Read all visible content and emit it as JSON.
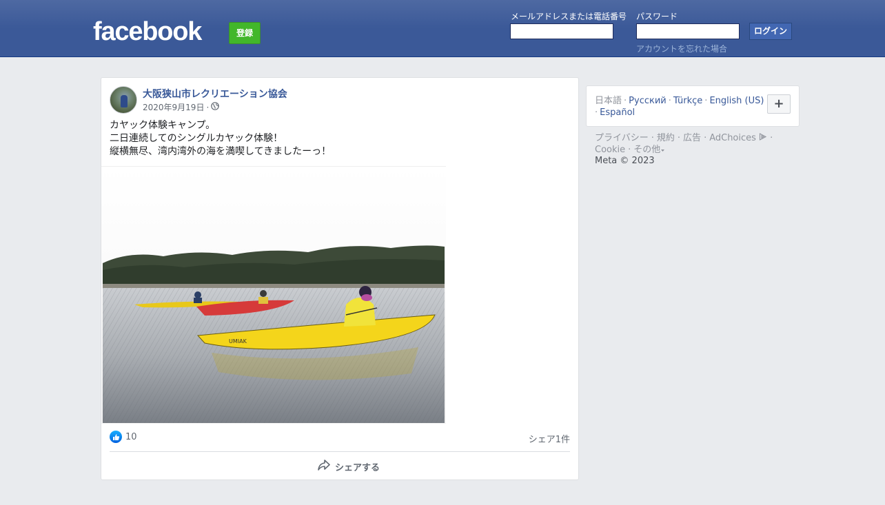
{
  "header": {
    "logo": "facebook",
    "signup_label": "登録",
    "email_label": "メールアドレスまたは電話番号",
    "password_label": "パスワード",
    "login_label": "ログイン",
    "forgot_label": "アカウントを忘れた場合",
    "email_value": "",
    "password_value": ""
  },
  "post": {
    "page_name": "大阪狭山市レクリエーション協会",
    "date": "2020年9月19日",
    "date_suffix": "·",
    "text_lines": [
      "カヤック体験キャンプ。",
      "二日連続してのシングルカヤック体験！",
      "縦横無尽、湾内湾外の海を満喫してきましたーっ！"
    ],
    "photo_boat_label": "UMIAK",
    "like_count": "10",
    "share_count": "シェア1件",
    "share_button": "シェアする"
  },
  "sidebar": {
    "languages": [
      {
        "label": "日本語",
        "active": true
      },
      {
        "label": "Русский",
        "active": false
      },
      {
        "label": "Türkçe",
        "active": false
      },
      {
        "label": "English (US)",
        "active": false
      },
      {
        "label": "Español",
        "active": false
      }
    ],
    "more_languages": "+",
    "footer_links": [
      "プライバシー",
      "規約",
      "広告",
      "AdChoices",
      "Cookie",
      "その他"
    ],
    "copyright": "Meta © 2023"
  },
  "colors": {
    "header": "#3b5998",
    "signup": "#42b72a",
    "link": "#385898",
    "background": "#e9ebee"
  },
  "icons": [
    "globe-icon",
    "like-icon",
    "share-icon",
    "adchoices-icon",
    "caret-down-icon"
  ]
}
